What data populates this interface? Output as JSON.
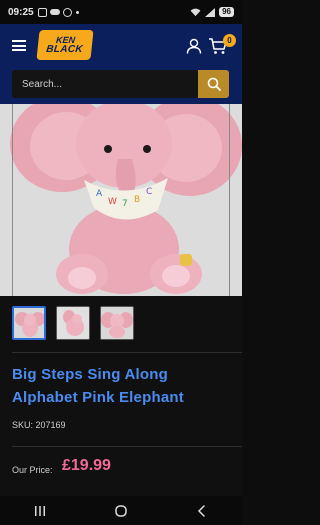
{
  "status_bar": {
    "time": "09:25",
    "battery": "96"
  },
  "header": {
    "logo_line1": "KEN",
    "logo_line2": "BLACK",
    "cart_count": "0"
  },
  "search": {
    "placeholder": "Search..."
  },
  "product": {
    "title": "Big Steps Sing Along Alphabet Pink Elephant",
    "sku": "SKU: 207169",
    "price_label": "Our Price:",
    "price": "£19.99",
    "image_count": 3,
    "selected_thumbnail": 1
  },
  "colors": {
    "header_bg": "#0b1f5c",
    "accent_yellow": "#f6a91a",
    "search_button": "#b88b28",
    "title_blue": "#4b8bf0",
    "price_pink": "#f06a95",
    "thumb_selected": "#2d6bd8"
  },
  "icons": {
    "menu": "hamburger-icon",
    "account": "user-icon",
    "cart": "cart-icon",
    "search": "search-icon",
    "nav_recent": "recent-apps-icon",
    "nav_home": "home-icon",
    "nav_back": "back-icon"
  }
}
